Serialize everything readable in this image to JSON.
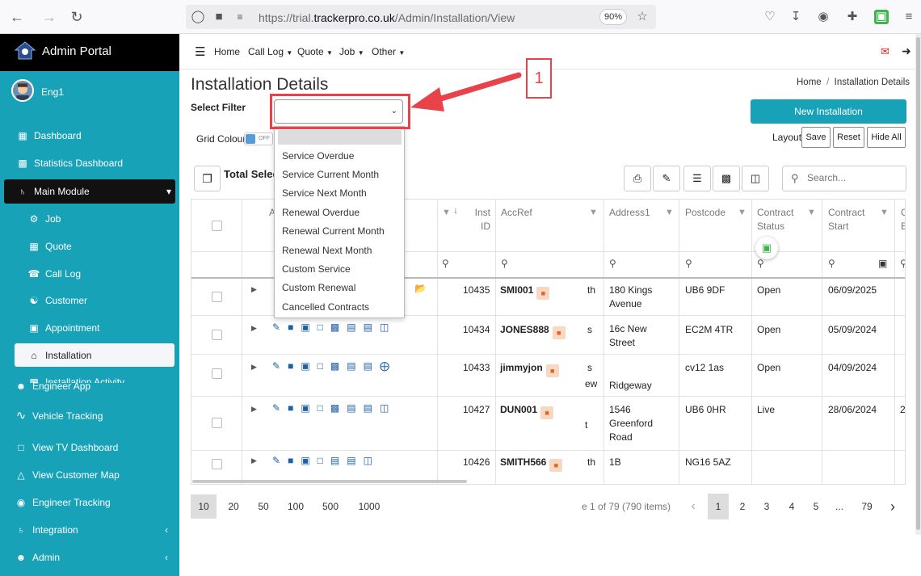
{
  "browser": {
    "url_prefix": "https://trial.",
    "url_domain": "trackerpro.co.uk",
    "url_path": "/Admin/Installation/View",
    "zoom": "90%"
  },
  "sidebar": {
    "title": "Admin Portal",
    "user": "Eng1",
    "items": [
      {
        "label": "Dashboard",
        "icon": "grid-icon"
      },
      {
        "label": "Statistics Dashboard",
        "icon": "bar-chart-icon"
      },
      {
        "label": "Main Module",
        "icon": "plug-icon"
      },
      {
        "label": "Job",
        "icon": "wrench-icon"
      },
      {
        "label": "Quote",
        "icon": "calculator-icon"
      },
      {
        "label": "Call Log",
        "icon": "user-phone-icon"
      },
      {
        "label": "Customer",
        "icon": "users-icon"
      },
      {
        "label": "Appointment",
        "icon": "calendar-check-icon"
      },
      {
        "label": "Installation",
        "icon": "home-icon"
      },
      {
        "label": "Installation Activity",
        "icon": "chart-icon"
      },
      {
        "label": "Engineer App",
        "icon": "engineer-icon"
      },
      {
        "label": "Vehicle Tracking",
        "icon": "route-icon"
      },
      {
        "label": "View TV Dashboard",
        "icon": "tv-icon"
      },
      {
        "label": "View Customer Map",
        "icon": "map-icon"
      },
      {
        "label": "Engineer Tracking",
        "icon": "pin-icon"
      },
      {
        "label": "Integration",
        "icon": "plug-icon"
      },
      {
        "label": "Admin",
        "icon": "user-icon"
      }
    ]
  },
  "topnav": {
    "home": "Home",
    "calllog": "Call Log",
    "quote": "Quote",
    "job": "Job",
    "other": "Other"
  },
  "page": {
    "title": "Installation Details",
    "breadcrumb_home": "Home",
    "breadcrumb_sep": "/",
    "breadcrumb_current": "Installation Details",
    "filter_label": "Select Filter",
    "grid_colour_label": "Grid Colour",
    "toggle_state": "OFF",
    "new_button": "New Installation",
    "layout_label": "Layout",
    "save": "Save",
    "reset": "Reset",
    "hide_all": "Hide All",
    "total_selected": "Total Selec",
    "search_placeholder": "Search..."
  },
  "filter_options": [
    "Service Overdue",
    "Service Current Month",
    "Service Next Month",
    "Renewal Overdue",
    "Renewal Current Month",
    "Renewal Next Month",
    "Custom Service",
    "Custom Renewal",
    "Cancelled Contracts"
  ],
  "table": {
    "headers": {
      "a": "A",
      "inst_id_1": "Inst",
      "inst_id_2": "ID",
      "accref": "AccRef",
      "address": "Address1",
      "postcode": "Postcode",
      "cs1": "Contract",
      "cs2": "Status",
      "cst1": "Contract",
      "cst2": "Start",
      "ce1": "C",
      "ce2": "E"
    },
    "rows": [
      {
        "id": "10435",
        "ref": "SMI001",
        "frag": "th",
        "addr": "180 Kings Avenue",
        "post": "UB6 9DF",
        "status": "Open",
        "start": "06/09/2025",
        "end": ""
      },
      {
        "id": "10434",
        "ref": "JONES888",
        "frag": "s",
        "addr": "16c New Street",
        "post": "EC2M 4TR",
        "status": "Open",
        "start": "05/09/2024",
        "end": ""
      },
      {
        "id": "10433",
        "ref": "jimmyjon",
        "frag": "s",
        "frag2": "ew",
        "addr": "Ridgeway",
        "post": "cv12 1as",
        "status": "Open",
        "start": "04/09/2024",
        "end": ""
      },
      {
        "id": "10427",
        "ref": "DUN001",
        "frag": "t",
        "addr": "1546 Greenford Road",
        "post": "UB6 0HR",
        "status": "Live",
        "start": "28/06/2024",
        "end": "2"
      },
      {
        "id": "10426",
        "ref": "SMITH566",
        "frag": "th",
        "addr": "1B",
        "post": "NG16 5AZ",
        "status": "",
        "start": "",
        "end": ""
      }
    ]
  },
  "pager": {
    "sizes": [
      "10",
      "20",
      "50",
      "100",
      "500",
      "1000"
    ],
    "info": "e 1 of 79 (790 items)",
    "pages": [
      "1",
      "2",
      "3",
      "4",
      "5",
      "...",
      "79"
    ]
  },
  "annotation": {
    "number": "1"
  },
  "colors": {
    "accent": "#17a2b8",
    "sidebar_head": "#000000",
    "annotation": "#e8424a"
  }
}
